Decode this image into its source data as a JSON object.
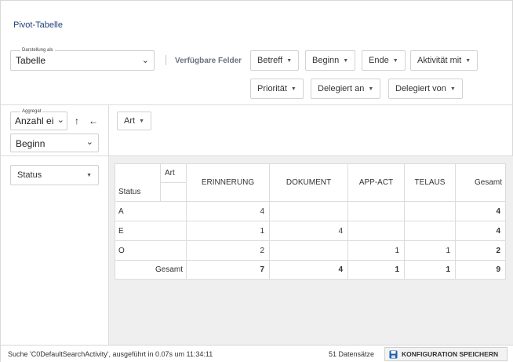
{
  "title": "Pivot-Tabelle",
  "darstellung": {
    "legend": "Darstellung als",
    "value": "Tabelle"
  },
  "available_fields_label": "Verfügbare Felder",
  "available_fields": [
    "Betreff",
    "Beginn",
    "Ende",
    "Aktivität mit",
    "Priorität",
    "Delegiert an",
    "Delegiert von"
  ],
  "aggregate": {
    "legend": "Aggregat",
    "value": "Anzahl ei",
    "field_value": "Beginn",
    "sort_icon": "↑",
    "arrow_icon": "←"
  },
  "column_field": "Art",
  "row_field": "Status",
  "pivot": {
    "col_attr_label": "Art",
    "row_attr_label": "Status",
    "columns": [
      "ERINNERUNG",
      "DOKUMENT",
      "APP-ACT",
      "TELAUS",
      "Gesamt"
    ],
    "rows": [
      {
        "label": "A",
        "values": [
          "4",
          "",
          "",
          "",
          "4"
        ]
      },
      {
        "label": "E",
        "values": [
          "1",
          "4",
          "",
          "",
          "4"
        ]
      },
      {
        "label": "O",
        "values": [
          "2",
          "",
          "1",
          "1",
          "2"
        ]
      }
    ],
    "total_label": "Gesamt",
    "totals": [
      "7",
      "4",
      "1",
      "1",
      "9"
    ]
  },
  "status_bar": {
    "text": "Suche 'C0DefaultSearchActivity', ausgeführt in 0.07s um 11:34:11",
    "records": "51 Datensätze",
    "save_label": "KONFIGURATION SPEICHERN"
  }
}
